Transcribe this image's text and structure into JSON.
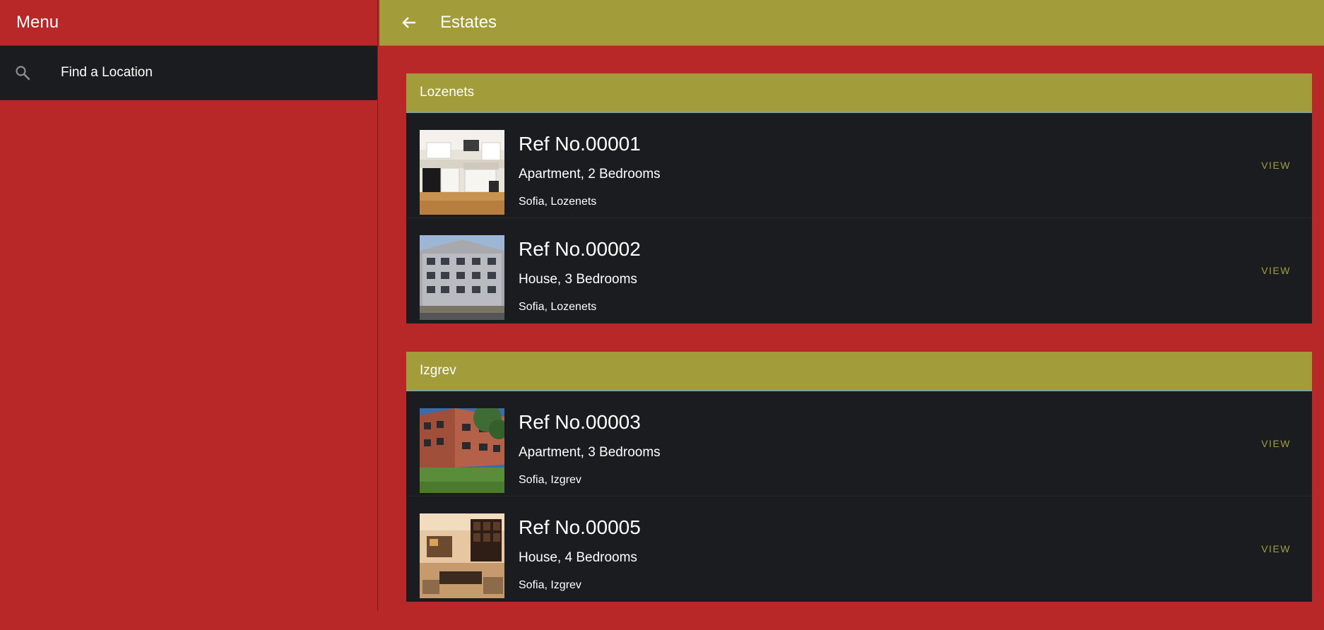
{
  "sidebar": {
    "title": "Menu",
    "search_label": "Find a Location"
  },
  "header": {
    "title": "Estates"
  },
  "groups": [
    {
      "name": "Lozenets",
      "items": [
        {
          "ref": "Ref No.00001",
          "type": "Apartment, 2 Bedrooms",
          "location": "Sofia, Lozenets",
          "action": "VIEW"
        },
        {
          "ref": "Ref No.00002",
          "type": "House, 3 Bedrooms",
          "location": "Sofia, Lozenets",
          "action": "VIEW"
        }
      ]
    },
    {
      "name": "Izgrev",
      "items": [
        {
          "ref": "Ref No.00003",
          "type": "Apartment, 3 Bedrooms",
          "location": "Sofia, Izgrev",
          "action": "VIEW"
        },
        {
          "ref": "Ref No.00005",
          "type": "House, 4 Bedrooms",
          "location": "Sofia, Izgrev",
          "action": "VIEW"
        }
      ]
    }
  ],
  "colors": {
    "primary": "#b82828",
    "accent": "#a29c3a",
    "surface": "#1b1c20"
  }
}
